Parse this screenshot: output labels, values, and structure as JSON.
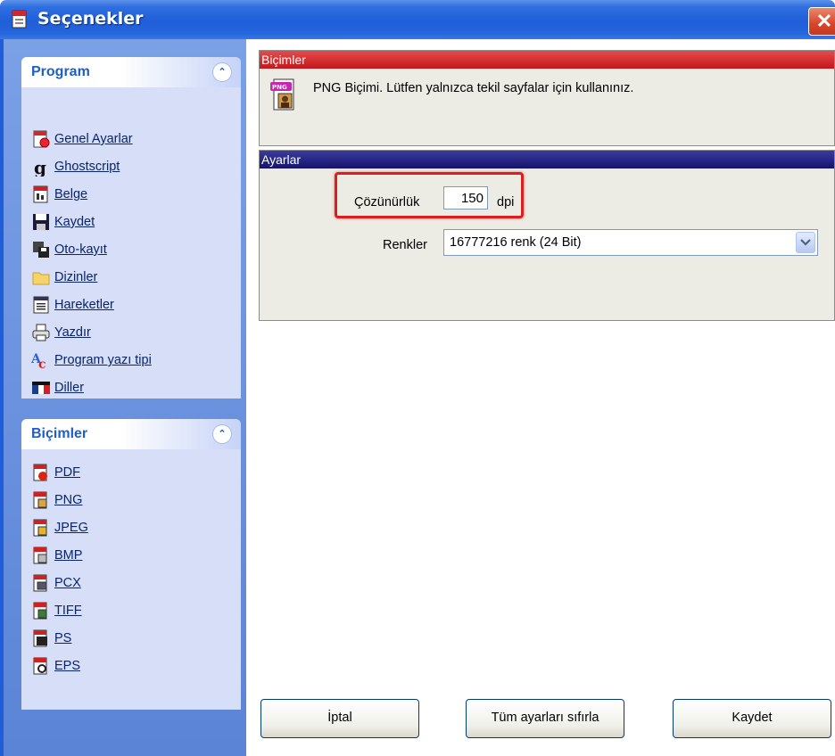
{
  "window": {
    "title": "Seçenekler",
    "close_glyph": "✕"
  },
  "sidebar": {
    "program_group": {
      "title": "Program",
      "collapse_glyph": "⌃",
      "items": [
        {
          "label": "Genel Ayarlar",
          "icon": "general-settings-icon"
        },
        {
          "label": "Ghostscript",
          "icon": "ghostscript-icon"
        },
        {
          "label": "Belge",
          "icon": "document-icon"
        },
        {
          "label": "Kaydet",
          "icon": "floppy-disk-icon"
        },
        {
          "label": "Oto-kayıt",
          "icon": "autosave-icon"
        },
        {
          "label": "Dizinler",
          "icon": "folder-icon"
        },
        {
          "label": "Hareketler",
          "icon": "actions-icon"
        },
        {
          "label": "Yazdır",
          "icon": "printer-icon"
        },
        {
          "label": "Program yazı tipi",
          "icon": "font-icon"
        },
        {
          "label": "Diller",
          "icon": "languages-flag-icon"
        }
      ]
    },
    "formats_group": {
      "title": "Biçimler",
      "collapse_glyph": "⌃",
      "items": [
        {
          "label": "PDF",
          "icon": "pdf-icon"
        },
        {
          "label": "PNG",
          "icon": "png-icon"
        },
        {
          "label": "JPEG",
          "icon": "jpeg-icon"
        },
        {
          "label": "BMP",
          "icon": "bmp-icon"
        },
        {
          "label": "PCX",
          "icon": "pcx-icon"
        },
        {
          "label": "TIFF",
          "icon": "tiff-icon"
        },
        {
          "label": "PS",
          "icon": "ps-icon"
        },
        {
          "label": "EPS",
          "icon": "eps-icon"
        }
      ]
    }
  },
  "main": {
    "formats_panel": {
      "header": "Biçimler",
      "icon_badge": "PNG",
      "description": "PNG Biçimi. Lütfen yalnızca tekil sayfalar için kullanınız."
    },
    "settings_panel": {
      "header": "Ayarlar",
      "resolution_label": "Çözünürlük",
      "resolution_value": "150",
      "resolution_unit": "dpi",
      "colors_label": "Renkler",
      "colors_value": "16777216 renk (24 Bit)"
    }
  },
  "buttons": {
    "cancel": "İptal",
    "reset_all": "Tüm ayarları sıfırla",
    "save": "Kaydet"
  },
  "colors": {
    "titlebar": "#2461d9",
    "formats_header": "#c4161c",
    "settings_header": "#14146e",
    "highlight_border": "#d9201e"
  }
}
